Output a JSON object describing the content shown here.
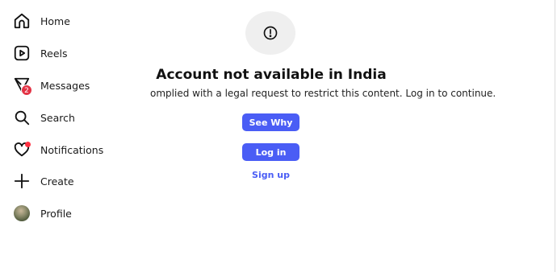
{
  "sidebar": {
    "items": [
      {
        "label": "Home",
        "icon": "home-icon"
      },
      {
        "label": "Reels",
        "icon": "reels-icon"
      },
      {
        "label": "Messages",
        "icon": "messages-icon",
        "badge": "2"
      },
      {
        "label": "Search",
        "icon": "search-icon"
      },
      {
        "label": "Notifications",
        "icon": "heart-icon"
      },
      {
        "label": "Create",
        "icon": "plus-icon"
      },
      {
        "label": "Profile",
        "icon": "avatar"
      }
    ]
  },
  "main": {
    "icon": "exclamation-circle-icon",
    "title": "Account not available in India",
    "subtitle": "omplied with a legal request to restrict this content. Log in to continue.",
    "see_why_label": "See Why",
    "login_label": "Log in",
    "signup_label": "Sign up"
  },
  "colors": {
    "primary_button": "#4a5df5",
    "badge": "#e33345",
    "icon_circle_bg": "#efefef"
  }
}
